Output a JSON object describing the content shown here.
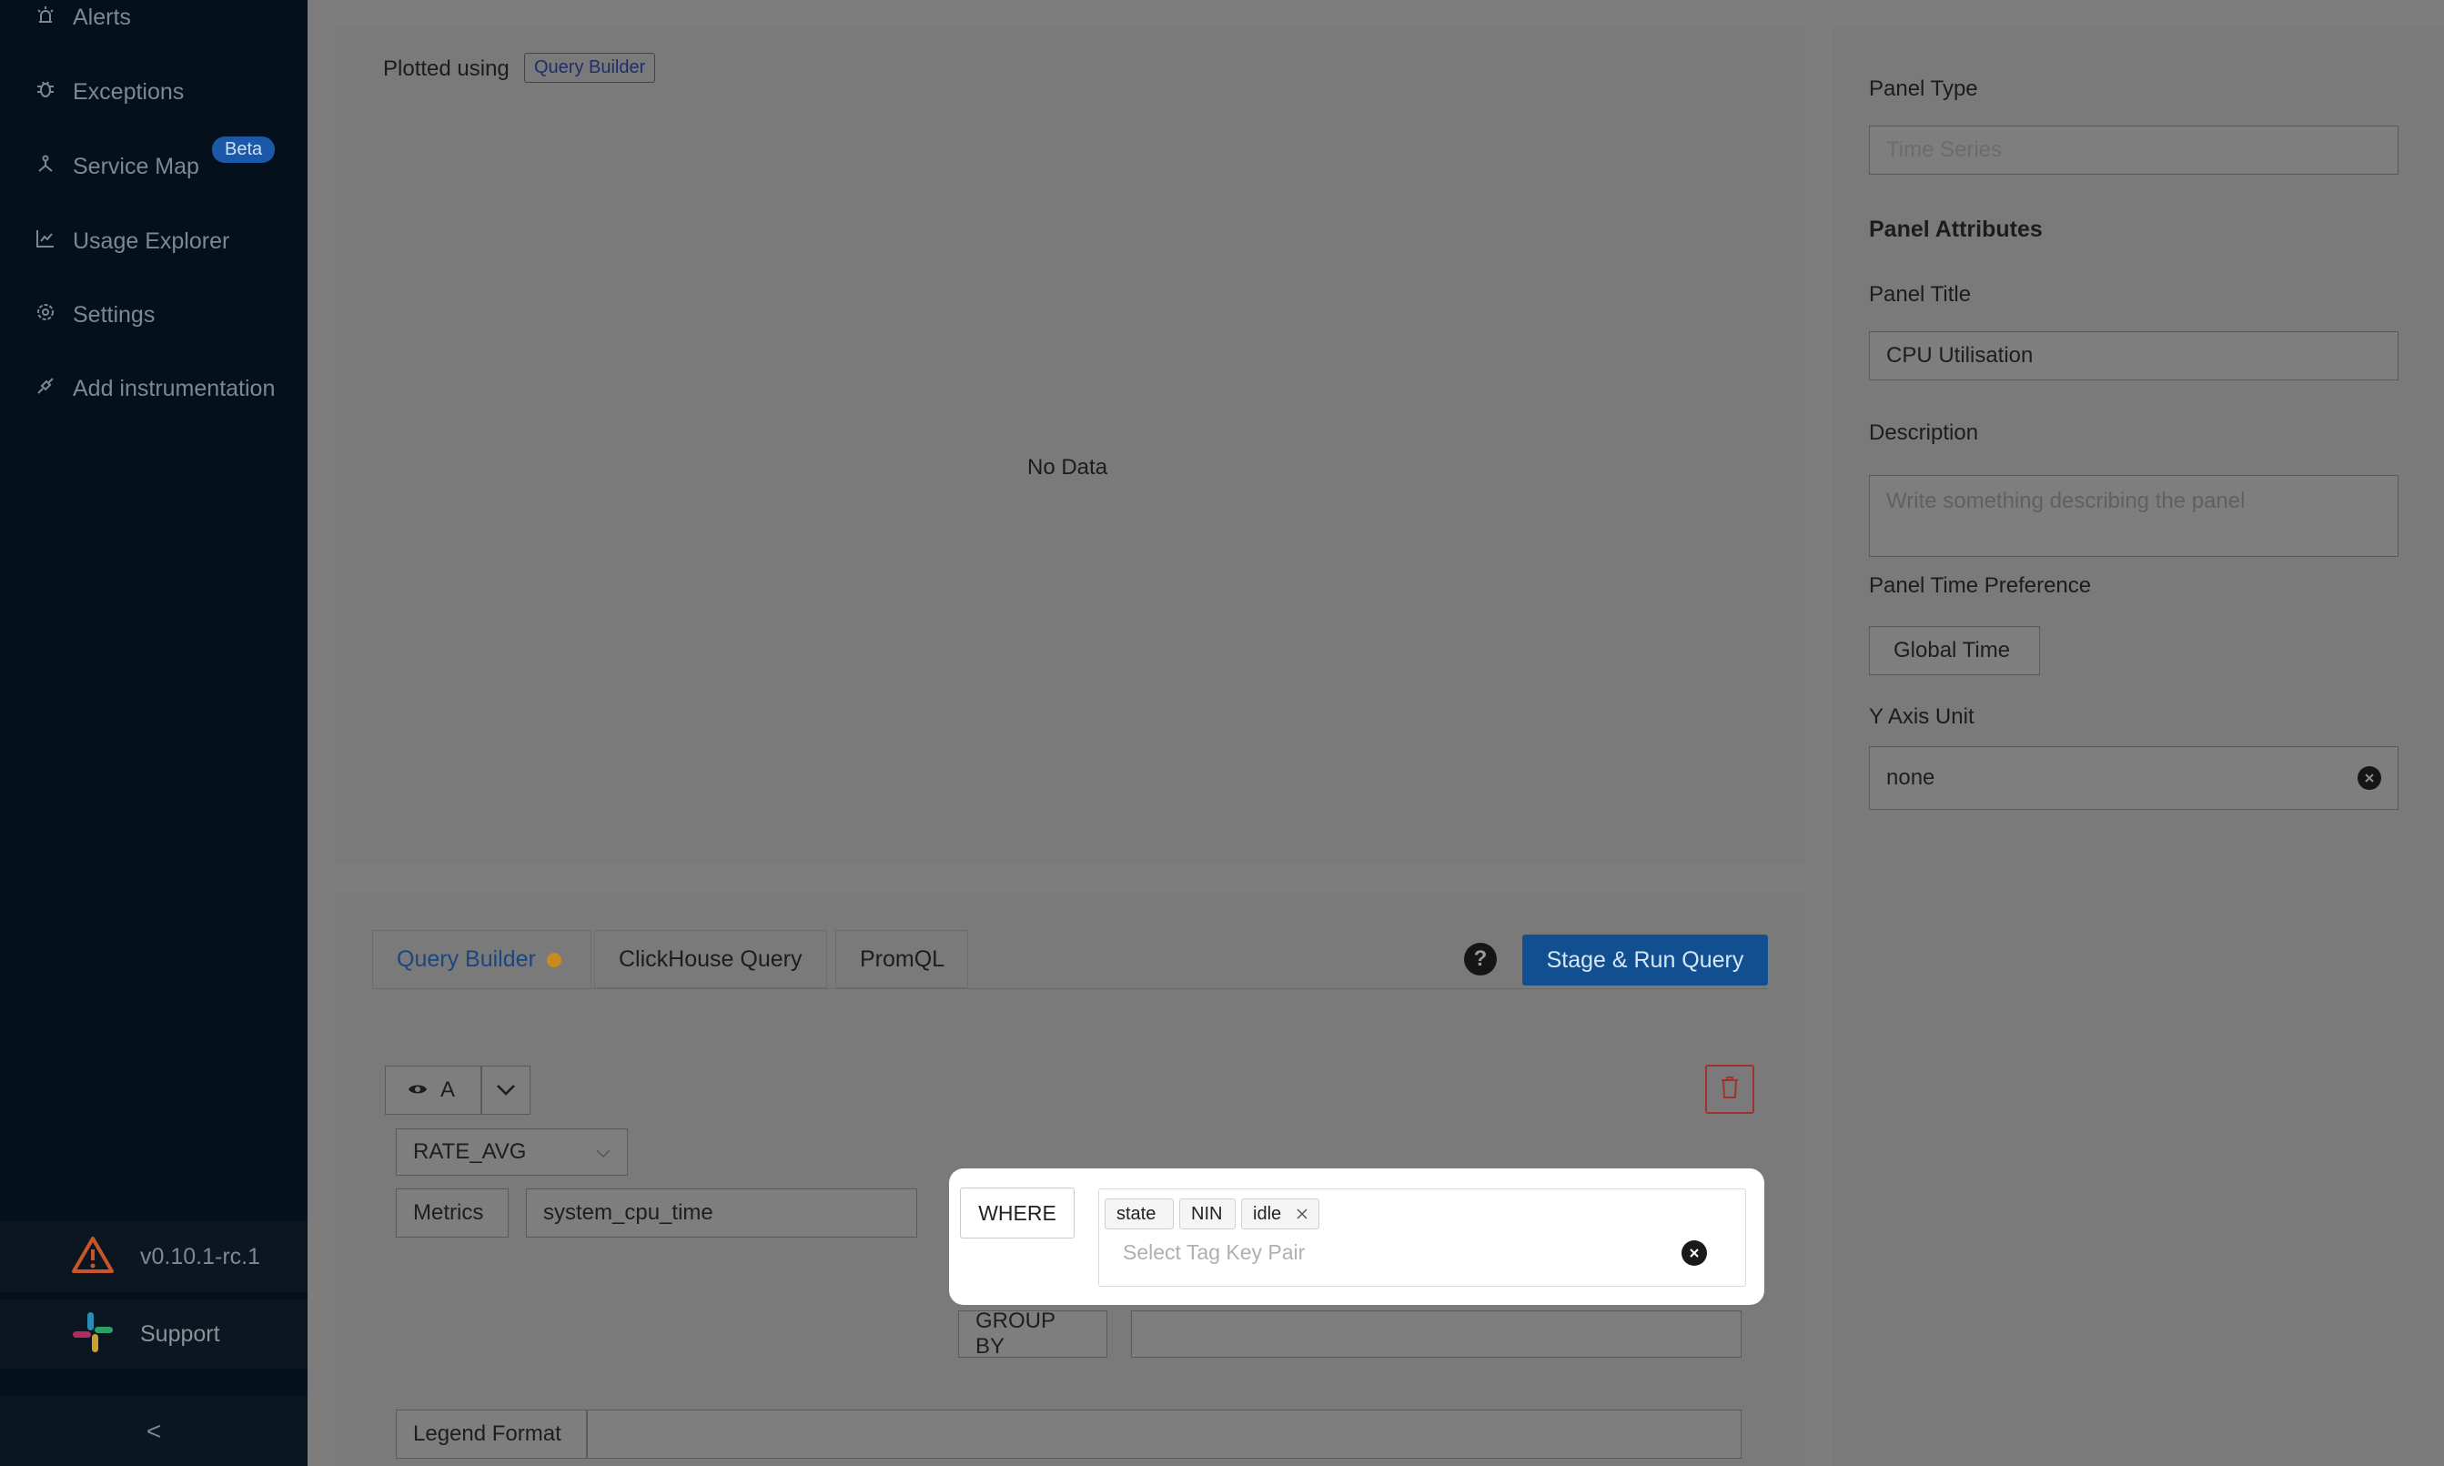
{
  "sidebar": {
    "items": [
      {
        "label": "Alerts",
        "icon": "alarm-icon"
      },
      {
        "label": "Exceptions",
        "icon": "bug-icon"
      },
      {
        "label": "Service Map",
        "icon": "network-icon"
      },
      {
        "label": "Usage Explorer",
        "icon": "line-chart-icon"
      },
      {
        "label": "Settings",
        "icon": "gear-icon"
      },
      {
        "label": "Add instrumentation",
        "icon": "api-icon"
      }
    ],
    "beta_badge": "Beta",
    "version": "v0.10.1-rc.1",
    "support": "Support",
    "collapse_glyph": "<"
  },
  "chart": {
    "plotted_using": "Plotted using",
    "plotted_tag": "Query Builder",
    "no_data": "No Data"
  },
  "query": {
    "tabs": [
      "Query Builder",
      "ClickHouse Query",
      "PromQL"
    ],
    "active_dot_color": "#c98a1f",
    "help_glyph": "?",
    "run_button": "Stage & Run Query",
    "query_name": "A",
    "aggregation": "RATE_AVG",
    "metrics_label": "Metrics",
    "metrics_value": "system_cpu_time",
    "where_label": "WHERE",
    "tags": [
      "state",
      "NIN",
      "idle"
    ],
    "tag_placeholder": "Select Tag Key Pair",
    "group_by_label": "GROUP BY",
    "legend_label": "Legend Format"
  },
  "settings": {
    "panel_type_label": "Panel Type",
    "panel_type_value": "Time Series",
    "attributes_heading": "Panel Attributes",
    "title_label": "Panel Title",
    "title_value": "CPU Utilisation",
    "description_label": "Description",
    "description_placeholder": "Write something describing the  panel",
    "time_pref_label": "Panel Time Preference",
    "time_pref_value": "Global Time",
    "y_unit_label": "Y Axis Unit",
    "y_unit_value": "none"
  }
}
